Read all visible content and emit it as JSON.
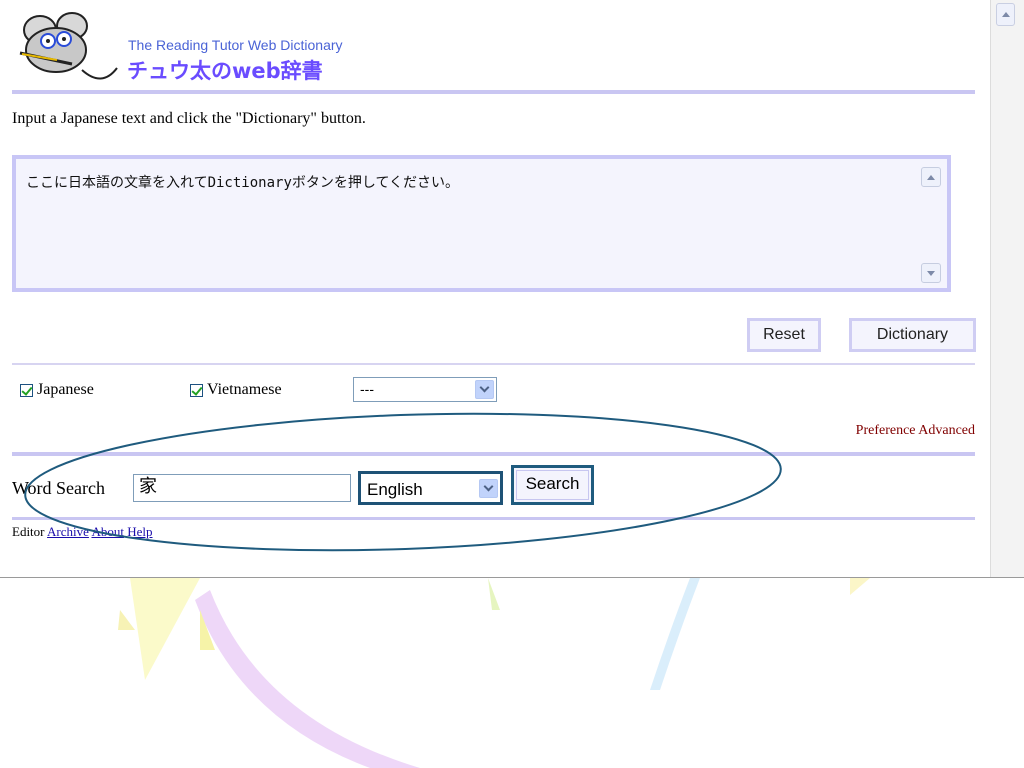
{
  "header": {
    "title": "The Reading Tutor Web Dictionary",
    "subtitle": "チュウ太のweb辞書"
  },
  "instruction": "Input a Japanese text and click the \"Dictionary\" button.",
  "text_input": {
    "value": "ここに日本語の文章を入れてDictionaryボタンを押してください。"
  },
  "buttons": {
    "reset": "Reset",
    "dictionary": "Dictionary",
    "search": "Search"
  },
  "options": {
    "japanese_label": "Japanese",
    "japanese_checked": true,
    "vietnamese_label": "Vietnamese",
    "vietnamese_checked": true,
    "language_select_value": "---"
  },
  "preference_links": "Preference Advanced",
  "word_search": {
    "label": "Word Search",
    "value": "家",
    "language_value": "English"
  },
  "footer": {
    "editor": "Editor",
    "archive": "Archive",
    "about": "About",
    "help": "Help"
  },
  "colors": {
    "accent": "#c9c6f2",
    "title_blue": "#4a63d6",
    "subtitle_purple": "#6a4cff",
    "annotation": "#1f5b7e"
  },
  "icons": {
    "logo": "mouse-with-glasses-logo",
    "scroll_up": "scroll-up-arrow-icon",
    "scroll_down": "scroll-down-arrow-icon",
    "dropdown": "dropdown-arrow-icon"
  }
}
